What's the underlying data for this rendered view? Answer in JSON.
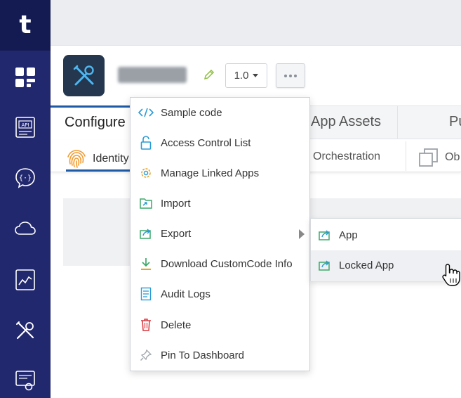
{
  "nav": {
    "logo_letter": "t",
    "items": [
      {
        "icon": "dashboard-icon"
      },
      {
        "icon": "api-icon",
        "text": "API"
      },
      {
        "icon": "chat-braces-icon"
      },
      {
        "icon": "cloud-icon"
      },
      {
        "icon": "chart-icon"
      },
      {
        "icon": "tools-icon"
      },
      {
        "icon": "certificate-icon"
      }
    ]
  },
  "app": {
    "name": "testImport",
    "version": "1.0"
  },
  "tabs": {
    "configure": "Configure",
    "app_assets": "App Assets",
    "publish_partial": "Pu"
  },
  "subtabs": {
    "identity": "Identity",
    "orchestration": "Orchestration",
    "objects_partial": "Ob"
  },
  "menu": {
    "items": [
      {
        "label": "Sample code",
        "icon": "code-icon"
      },
      {
        "label": "Access Control List",
        "icon": "lock-icon"
      },
      {
        "label": "Manage Linked Apps",
        "icon": "gear-link-icon"
      },
      {
        "label": "Import",
        "icon": "import-icon"
      },
      {
        "label": "Export",
        "icon": "export-icon"
      },
      {
        "label": "Download CustomCode Info",
        "icon": "download-icon"
      },
      {
        "label": "Audit Logs",
        "icon": "audit-log-icon"
      },
      {
        "label": "Delete",
        "icon": "trash-icon"
      },
      {
        "label": "Pin To Dashboard",
        "icon": "pin-icon"
      }
    ]
  },
  "submenu": {
    "items": [
      {
        "label": "App",
        "icon": "export-icon"
      },
      {
        "label": "Locked App",
        "icon": "export-icon"
      }
    ]
  },
  "colors": {
    "nav_bg": "#22286e",
    "logo_bg": "#141b52",
    "accent": "#1f5aa6",
    "icon_teal": "#2b9bd6",
    "icon_green": "#3da86a",
    "icon_red": "#d9363e"
  }
}
